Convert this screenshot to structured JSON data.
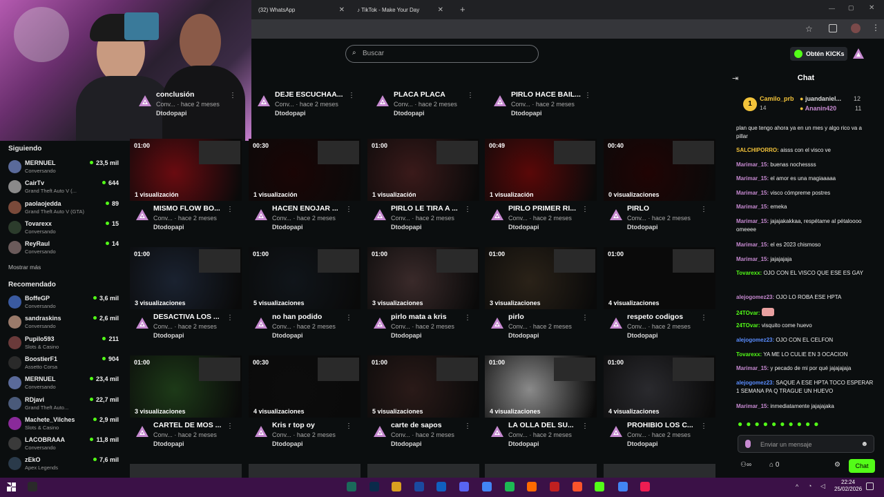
{
  "browser": {
    "tabs": [
      {
        "label": "(32) WhatsApp"
      },
      {
        "label": "TikTok - Make Your Day"
      }
    ]
  },
  "header": {
    "search_placeholder": "Buscar",
    "kicks_label": "Obtén KICKs"
  },
  "sidebar": {
    "following_title": "Siguiendo",
    "following": [
      {
        "name": "MERNUEL",
        "sub": "Conversando",
        "count": "23,5 mil",
        "color": "#5a6a9a"
      },
      {
        "name": "CairTv",
        "sub": "Grand Theft Auto V (...",
        "count": "644",
        "color": "#8a8a8a"
      },
      {
        "name": "paolaojedda",
        "sub": "Grand Theft Auto V (GTA)",
        "count": "89",
        "color": "#7a4a3a"
      },
      {
        "name": "Tovarexx",
        "sub": "Conversando",
        "count": "15",
        "color": "#2c3c2c"
      },
      {
        "name": "ReyRaul",
        "sub": "Conversando",
        "count": "14",
        "color": "#6a5a5a"
      }
    ],
    "show_more": "Mostrar más",
    "recommended_title": "Recomendado",
    "recommended": [
      {
        "name": "BoffeGP",
        "sub": "Conversando",
        "count": "3,6 mil",
        "color": "#3a5aa0"
      },
      {
        "name": "sandraskins",
        "sub": "Conversando",
        "count": "2,6 mil",
        "color": "#9a7a6a"
      },
      {
        "name": "Pupilo593",
        "sub": "Slots & Casino",
        "count": "211",
        "color": "#6a3a3a"
      },
      {
        "name": "BoostierF1",
        "sub": "Assetto Corsa",
        "count": "904",
        "color": "#2a2a2a"
      },
      {
        "name": "MERNUEL",
        "sub": "Conversando",
        "count": "23,4 mil",
        "color": "#5a6a9a"
      },
      {
        "name": "RDjavi",
        "sub": "Grand Theft Auto...",
        "count": "22,7 mil",
        "color": "#4a5a7a"
      },
      {
        "name": "Machete_Vilches",
        "sub": "Slots & Casino",
        "count": "2,9 mil",
        "color": "#8a2a9a"
      },
      {
        "name": "LACOBRAAA",
        "sub": "Conversando",
        "count": "11,8 mil",
        "color": "#3a3a3a"
      },
      {
        "name": "zEkO",
        "sub": "Apex Legends",
        "count": "7,6 mil",
        "color": "#2a3a4a"
      }
    ]
  },
  "videos": {
    "meta_prefix": "Conv...",
    "meta_time": "hace 2 meses",
    "channel": "Dtodopapi",
    "row0": [
      {
        "title": "conclusión"
      },
      {
        "title": "DEJE ESCUCHAA..."
      },
      {
        "title": "PLACA PLACA"
      },
      {
        "title": "PIRLO HACE BAIL..."
      }
    ],
    "rows": [
      [
        {
          "duration": "01:00",
          "views": "1 visualización",
          "title": "MISMO FLOW BO...",
          "bg": "#6a0b10"
        },
        {
          "duration": "00:30",
          "views": "1 visualización",
          "title": "HACEN ENOJAR ...",
          "bg": "#1a0505"
        },
        {
          "duration": "01:00",
          "views": "1 visualización",
          "title": "PIRLO LE TIRA A ...",
          "bg": "#3a1a1a"
        },
        {
          "duration": "00:49",
          "views": "1 visualización",
          "title": "PIRLO PRIMER RI...",
          "bg": "#5a0808"
        },
        {
          "duration": "00:40",
          "views": "0 visualizaciones",
          "title": "PIRLO",
          "bg": "#200404"
        }
      ],
      [
        {
          "duration": "01:00",
          "views": "3 visualizaciones",
          "title": "DESACTIVA LOS ...",
          "bg": "#1a2230"
        },
        {
          "duration": "01:00",
          "views": "5 visualizaciones",
          "title": "no han podido",
          "bg": "#10151a"
        },
        {
          "duration": "01:00",
          "views": "3 visualizaciones",
          "title": "pirlo mata a kris",
          "bg": "#3a2a2a"
        },
        {
          "duration": "01:00",
          "views": "3 visualizaciones",
          "title": "pirlo",
          "bg": "#2a2218"
        },
        {
          "duration": "01:00",
          "views": "4 visualizaciones",
          "title": "respeto codigos",
          "bg": "#0a0a0a"
        }
      ],
      [
        {
          "duration": "01:00",
          "views": "3 visualizaciones",
          "title": "CARTEL DE MOS ...",
          "bg": "#1d3a18"
        },
        {
          "duration": "00:30",
          "views": "4 visualizaciones",
          "title": "Kris r top oy",
          "bg": "#0c0c0c"
        },
        {
          "duration": "01:00",
          "views": "5 visualizaciones",
          "title": "carte de sapos",
          "bg": "#2a1a18"
        },
        {
          "duration": "01:00",
          "views": "4 visualizaciones",
          "title": "LA OLLA DEL SU...",
          "bg": "#8a8a8a"
        },
        {
          "duration": "01:00",
          "views": "4 visualizaciones",
          "title": "PROHIBIO LOS C...",
          "bg": "#2a2a2e"
        }
      ]
    ]
  },
  "chat": {
    "title": "Chat",
    "leaders": [
      {
        "name": "Camilo_prb",
        "count": "14"
      },
      {
        "name": "juandaniel...",
        "count": "12"
      },
      {
        "name": "Ananin420",
        "count": "11"
      }
    ],
    "messages": [
      {
        "user": "",
        "text": "plan que tengo ahora ya en un mes y algo rico va a pillar",
        "color": "#eee"
      },
      {
        "user": "SALCHIPORRO:",
        "text": "aisss con el visco ve",
        "color": "#f3c33a"
      },
      {
        "user": "Marimar_15:",
        "text": "buenas nochessss",
        "color": "#c78ad1"
      },
      {
        "user": "Marimar_15:",
        "text": "el amor es una magiaaaaa",
        "color": "#c78ad1"
      },
      {
        "user": "Marimar_15:",
        "text": "visco cómpreme postres",
        "color": "#c78ad1"
      },
      {
        "user": "Marimar_15:",
        "text": "emeka",
        "color": "#c78ad1"
      },
      {
        "user": "Marimar_15:",
        "text": "jajajakakkaa, respétame al pétaloooo omeeee",
        "color": "#c78ad1"
      },
      {
        "user": "Marimar_15:",
        "text": "el es 2023 chismoso",
        "color": "#c78ad1"
      },
      {
        "user": "Marimar_15:",
        "text": "jajajajaja",
        "color": "#c78ad1"
      },
      {
        "user": "Tovarexx:",
        "text": "OJO CON EL VISCO QUE ESE ES GAY",
        "color": "#53fc18"
      },
      {
        "user": "alejogomez23:",
        "text": "OJO LO ROBA ESE HPTA",
        "color": "#c78ad1"
      },
      {
        "user": "24TOvar:",
        "text": "",
        "color": "#53fc18"
      },
      {
        "user": "24TOvar:",
        "text": "visquito come huevo",
        "color": "#53fc18"
      },
      {
        "user": "alejogomez23:",
        "text": "OJO CON EL CELFON",
        "color": "#5a8dff"
      },
      {
        "user": "Tovarexx:",
        "text": "YA ME LO CULIE EN 3 OCACION",
        "color": "#53fc18"
      },
      {
        "user": "Marimar_15:",
        "text": "y pecado de mi por qué jajajajaja",
        "color": "#c78ad1"
      },
      {
        "user": "alejogomez23:",
        "text": "SAQUE A ESE HPTA TOCO ESPERAR 1 SEMANA PA Q TRAGUE UN HUEVO",
        "color": "#5a8dff"
      },
      {
        "user": "Marimar_15:",
        "text": "inmediatamente jajajajaka",
        "color": "#c78ad1"
      }
    ],
    "input_placeholder": "Enviar un mensaje",
    "points": "0",
    "send_label": "Chat"
  },
  "taskbar": {
    "time": "22:24",
    "date": "25/02/2026"
  }
}
